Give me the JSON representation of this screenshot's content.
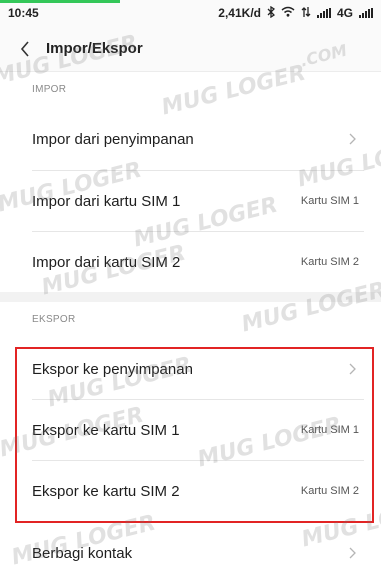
{
  "status_bar": {
    "time": "10:45",
    "speed": "2,41K/d",
    "network": "4G",
    "icons": [
      "bluetooth-icon",
      "wifi-icon",
      "data-icon",
      "signal-icon",
      "signal-icon"
    ]
  },
  "header": {
    "title": "Impor/Ekspor",
    "back_icon": "back-chevron-icon"
  },
  "impor": {
    "label": "IMPOR",
    "items": [
      {
        "label": "Impor dari penyimpanan",
        "value": ""
      },
      {
        "label": "Impor dari kartu SIM 1",
        "value": "Kartu SIM 1"
      },
      {
        "label": "Impor dari kartu SIM 2",
        "value": "Kartu SIM 2"
      }
    ]
  },
  "ekspor": {
    "label": "EKSPOR",
    "items": [
      {
        "label": "Ekspor ke penyimpanan",
        "value": ""
      },
      {
        "label": "Ekspor ke kartu SIM 1",
        "value": "Kartu SIM 1"
      },
      {
        "label": "Ekspor ke kartu SIM 2",
        "value": "Kartu SIM 2"
      },
      {
        "label": "Berbagi kontak",
        "value": ""
      }
    ]
  },
  "watermark": {
    "brand": "MUG LOGER",
    "domain": ".COM"
  },
  "colors": {
    "highlight": "#e22424",
    "progress": "#34c759"
  }
}
